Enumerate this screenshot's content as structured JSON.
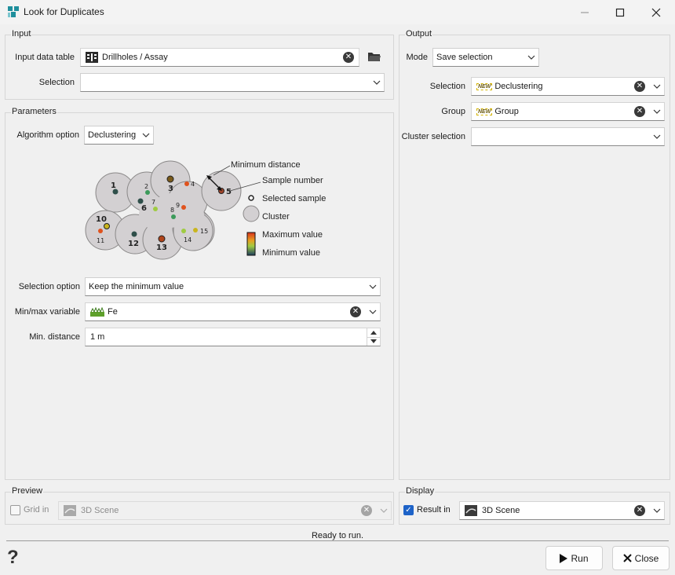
{
  "window": {
    "title": "Look for Duplicates"
  },
  "input": {
    "group_title": "Input",
    "data_table_label": "Input data table",
    "data_table_value": "Drillholes / Assay",
    "selection_label": "Selection",
    "selection_value": ""
  },
  "parameters": {
    "group_title": "Parameters",
    "algorithm_label": "Algorithm option",
    "algorithm_value": "Declustering",
    "diagram": {
      "min_distance": "Minimum distance",
      "sample_number": "Sample number",
      "selected_sample": "Selected sample",
      "cluster": "Cluster",
      "max_value": "Maximum value",
      "min_value": "Minimum value",
      "numbers": [
        "1",
        "2",
        "3",
        "4",
        "5",
        "6",
        "7",
        "8",
        "9",
        "10",
        "11",
        "12",
        "13",
        "14",
        "15"
      ]
    },
    "selection_option_label": "Selection option",
    "selection_option_value": "Keep the minimum value",
    "minmax_label": "Min/max variable",
    "minmax_value": "Fe",
    "min_distance_label": "Min. distance",
    "min_distance_value": "1 m"
  },
  "output": {
    "group_title": "Output",
    "mode_label": "Mode",
    "mode_value": "Save selection",
    "selection_label": "Selection",
    "selection_value": "Declustering",
    "group_label": "Group",
    "group_value": "Group",
    "cluster_label": "Cluster selection",
    "cluster_value": "",
    "new_badge": "NEW"
  },
  "preview": {
    "group_title": "Preview",
    "grid_in_label": "Grid in",
    "grid_in_checked": false,
    "scene_value": "3D Scene"
  },
  "display": {
    "group_title": "Display",
    "result_in_label": "Result in",
    "result_in_checked": true,
    "scene_value": "3D Scene"
  },
  "status": "Ready to run.",
  "buttons": {
    "run": "Run",
    "close": "Close",
    "help": "?"
  }
}
